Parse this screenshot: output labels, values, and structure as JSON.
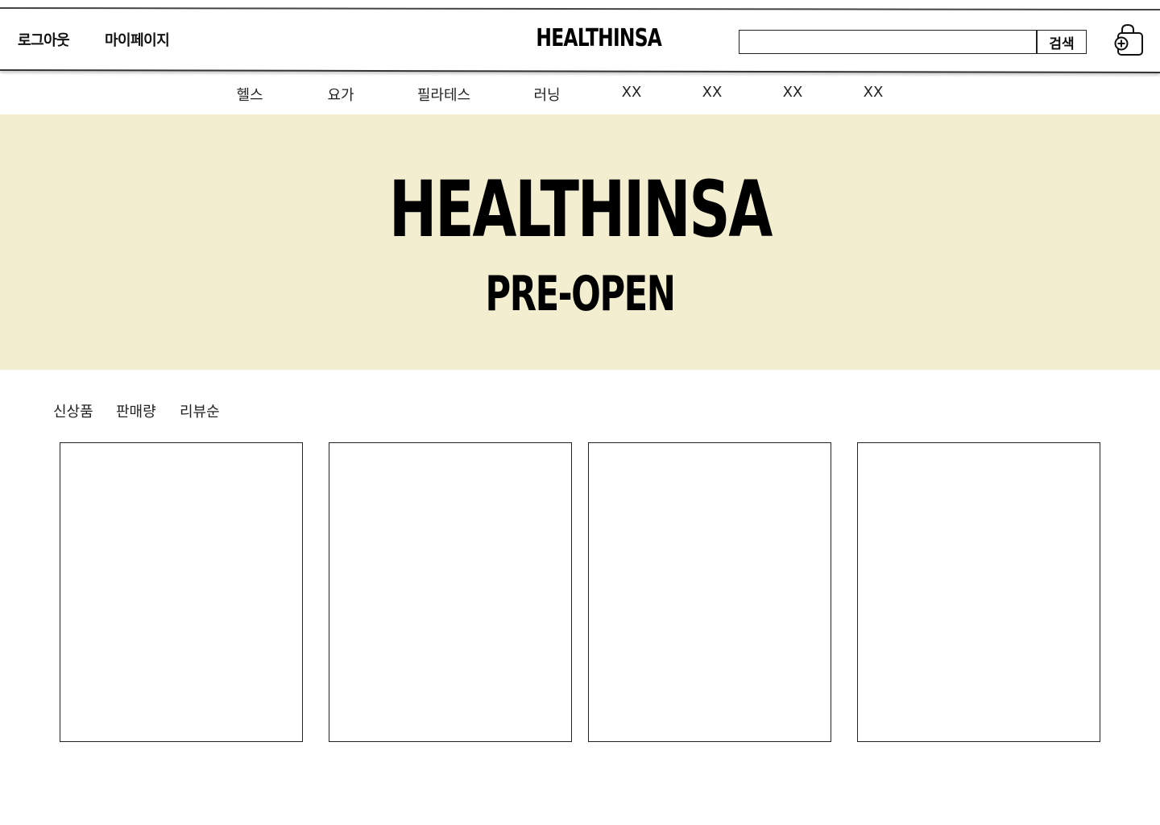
{
  "header": {
    "logout_label": "로그아웃",
    "mypage_label": "마이페이지",
    "logo_text": "HEALTHINSA",
    "search": {
      "value": "",
      "placeholder": "",
      "button_label": "검색"
    },
    "cart_icon": "shopping-bag-plus-icon"
  },
  "categories": [
    "헬스",
    "요가",
    "필라테스",
    "러닝",
    "XX",
    "XX",
    "XX",
    "XX"
  ],
  "hero": {
    "title": "HEALTHINSA",
    "subtitle": "PRE-OPEN",
    "background_color": "#f3eed0"
  },
  "sort_tabs": [
    "신상품",
    "판매량",
    "리뷰순"
  ],
  "products": [
    {},
    {},
    {},
    {}
  ]
}
